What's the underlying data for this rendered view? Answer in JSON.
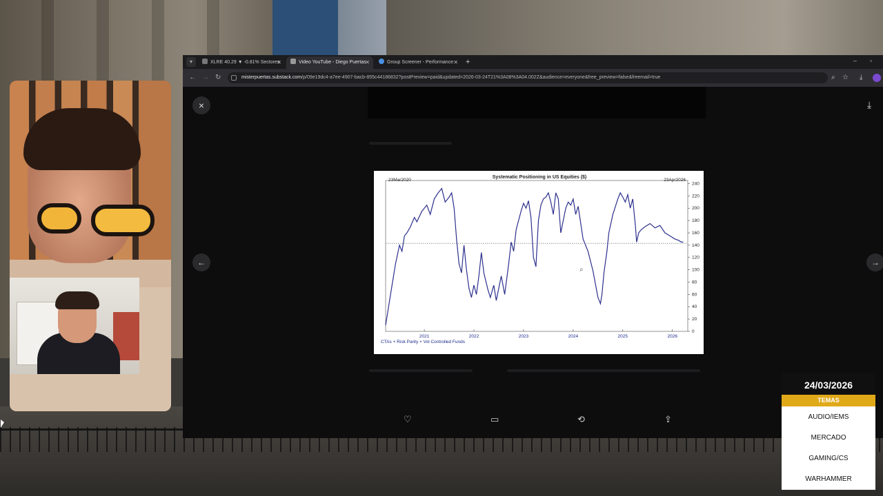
{
  "browser": {
    "tabs": [
      {
        "label": "XLRE 40.29 ▼ -0.81% Sectores",
        "active": false
      },
      {
        "label": "Video YouTube - Diego Puertas",
        "active": true
      },
      {
        "label": "Group Screener - Performance",
        "active": false
      }
    ],
    "new_tab": "+",
    "url_host": "misterpuertas.substack.com",
    "url_path": "/p/09e19dc4-a7ee-4907-bacb-855c44186832?postPreview=paid&updated=2026-03-24T21%3A08%3A04.002Z&audience=everyone&free_preview=false&freemail=true"
  },
  "viewer": {
    "close_icon": "×",
    "prev_icon": "←",
    "next_icon": "→",
    "download_icon": "⤓"
  },
  "chart_data": {
    "type": "line",
    "title": "Systematic Positioning in US Equities ($)",
    "start_label": "23Mar2020",
    "end_label": "23Apr2026",
    "footer": "CTAs + Risk Parity + Vol Controlled Funds",
    "x_ticks": [
      "2021",
      "2022",
      "2023",
      "2024",
      "2025",
      "2026"
    ],
    "y_ticks": [
      0,
      20,
      40,
      60,
      80,
      100,
      120,
      140,
      160,
      180,
      200,
      220,
      240
    ],
    "ylim": [
      0,
      245
    ],
    "xlim": [
      2020.22,
      2026.31
    ],
    "reference_line": 143,
    "series": [
      {
        "x": [
          2020.22,
          2020.28,
          2020.35,
          2020.42,
          2020.5,
          2020.55,
          2020.6,
          2020.65,
          2020.72,
          2020.8,
          2020.85,
          2020.95,
          2021.05,
          2021.12,
          2021.2,
          2021.28,
          2021.35,
          2021.42,
          2021.5,
          2021.55,
          2021.6,
          2021.65,
          2021.7,
          2021.75,
          2021.8,
          2021.85,
          2021.9,
          2021.95,
          2022.0,
          2022.05,
          2022.1,
          2022.15,
          2022.2,
          2022.28,
          2022.33,
          2022.4,
          2022.45,
          2022.5,
          2022.55,
          2022.62,
          2022.7,
          2022.75,
          2022.8,
          2022.85,
          2022.9,
          2022.95,
          2023.0,
          2023.05,
          2023.1,
          2023.15,
          2023.2,
          2023.25,
          2023.3,
          2023.35,
          2023.4,
          2023.45,
          2023.5,
          2023.55,
          2023.6,
          2023.65,
          2023.7,
          2023.75,
          2023.8,
          2023.85,
          2023.9,
          2023.95,
          2024.0,
          2024.05,
          2024.1,
          2024.2,
          2024.3,
          2024.4,
          2024.5,
          2024.55,
          2024.58,
          2024.62,
          2024.68,
          2024.72,
          2024.8,
          2024.9,
          2024.95,
          2025.0,
          2025.05,
          2025.1,
          2025.15,
          2025.2,
          2025.25,
          2025.28,
          2025.32,
          2025.37,
          2025.45,
          2025.55,
          2025.65,
          2025.75,
          2025.85,
          2025.95,
          2026.05,
          2026.12,
          2026.18,
          2026.22
        ],
        "y": [
          10,
          40,
          75,
          110,
          140,
          130,
          155,
          160,
          170,
          185,
          178,
          195,
          205,
          190,
          215,
          225,
          232,
          210,
          218,
          225,
          200,
          150,
          110,
          95,
          140,
          100,
          70,
          55,
          75,
          60,
          90,
          128,
          95,
          68,
          55,
          75,
          50,
          70,
          90,
          60,
          110,
          145,
          130,
          165,
          180,
          195,
          208,
          200,
          212,
          185,
          120,
          105,
          180,
          205,
          215,
          218,
          225,
          210,
          190,
          225,
          215,
          160,
          180,
          200,
          210,
          205,
          215,
          190,
          203,
          150,
          130,
          98,
          55,
          45,
          60,
          95,
          130,
          160,
          190,
          215,
          225,
          218,
          210,
          222,
          200,
          215,
          175,
          145,
          160,
          165,
          170,
          175,
          168,
          172,
          160,
          155,
          150,
          148,
          145,
          145
        ]
      }
    ]
  },
  "overlay": {
    "date": "24/03/2026",
    "header": "TEMAS",
    "topics": [
      "AUDIO/IEMS",
      "MERCADO",
      "GAMING/CS",
      "WARHAMMER"
    ]
  }
}
